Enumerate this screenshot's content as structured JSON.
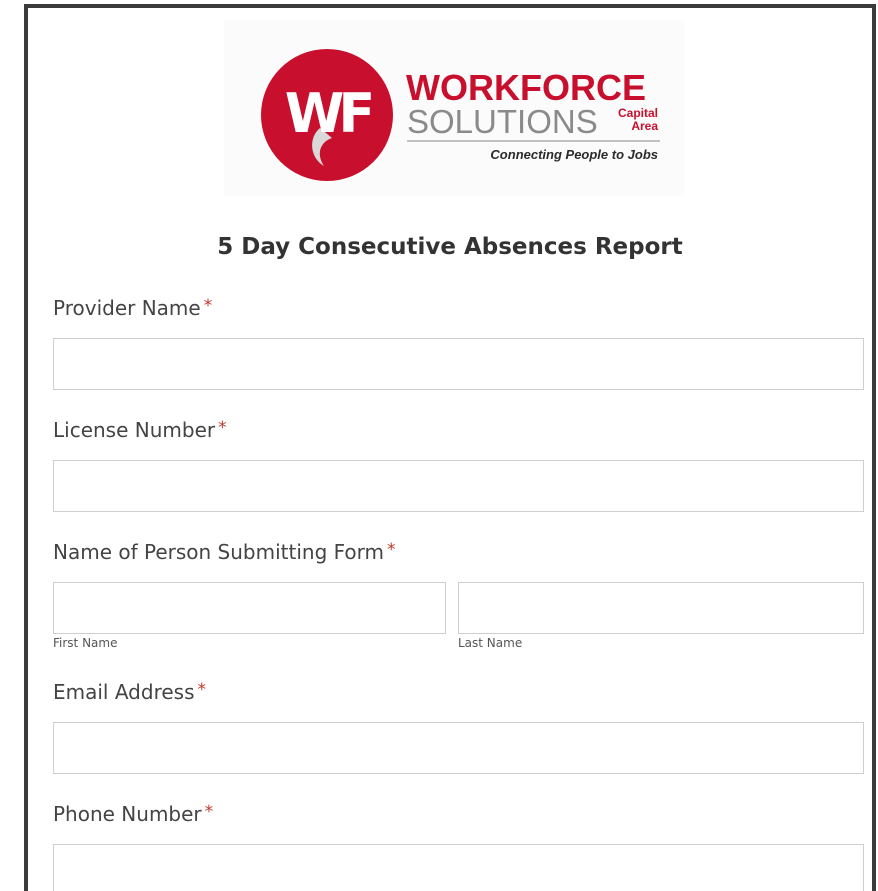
{
  "logo": {
    "monogram": "WF",
    "line1": "WORKFORCE",
    "line2": "SOLUTIONS",
    "region_top": "Capital",
    "region_bottom": "Area",
    "tagline": "Connecting People to Jobs",
    "colors": {
      "brand_red": "#c8102e",
      "gray": "#8a8a8a",
      "dark": "#2b2b2b"
    }
  },
  "form": {
    "title": "5 Day Consecutive Absences Report",
    "required_marker": "*",
    "fields": {
      "provider_name": {
        "label": "Provider Name",
        "value": ""
      },
      "license_number": {
        "label": "License Number",
        "value": ""
      },
      "submitter_name": {
        "label": "Name of Person Submitting Form",
        "first_label": "First Name",
        "first_value": "",
        "last_label": "Last Name",
        "last_value": ""
      },
      "email": {
        "label": "Email Address",
        "value": ""
      },
      "phone": {
        "label": "Phone Number",
        "value": ""
      }
    }
  },
  "colors": {
    "required": "#c0392b",
    "border": "#cfcfcf",
    "frame": "#3b3b3b"
  }
}
